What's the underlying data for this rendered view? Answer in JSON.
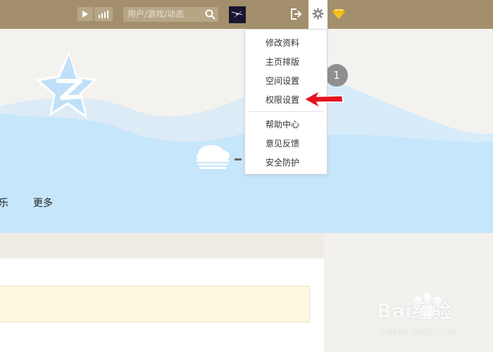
{
  "topbar": {
    "search_placeholder": "用户/游戏/动态",
    "icons": [
      "play-icon",
      "bars-icon",
      "search-icon",
      "avatar",
      "exit-icon",
      "gear-icon",
      "vip-diamond-icon"
    ]
  },
  "banner": {
    "nav": [
      "乐",
      "更多"
    ],
    "badge": "1"
  },
  "menu": {
    "group1": [
      "修改资料",
      "主页排版",
      "空间设置",
      "权限设置"
    ],
    "group2": [
      "帮助中心",
      "意见反馈",
      "安全防护"
    ],
    "highlighted": "权限设置"
  },
  "watermark": {
    "brand": "Bai经验",
    "url": "jingyan.baidu.com"
  },
  "colors": {
    "topbar": "#a38f6c",
    "wave": "#c6e6fb",
    "arrow": "#e5131c"
  }
}
